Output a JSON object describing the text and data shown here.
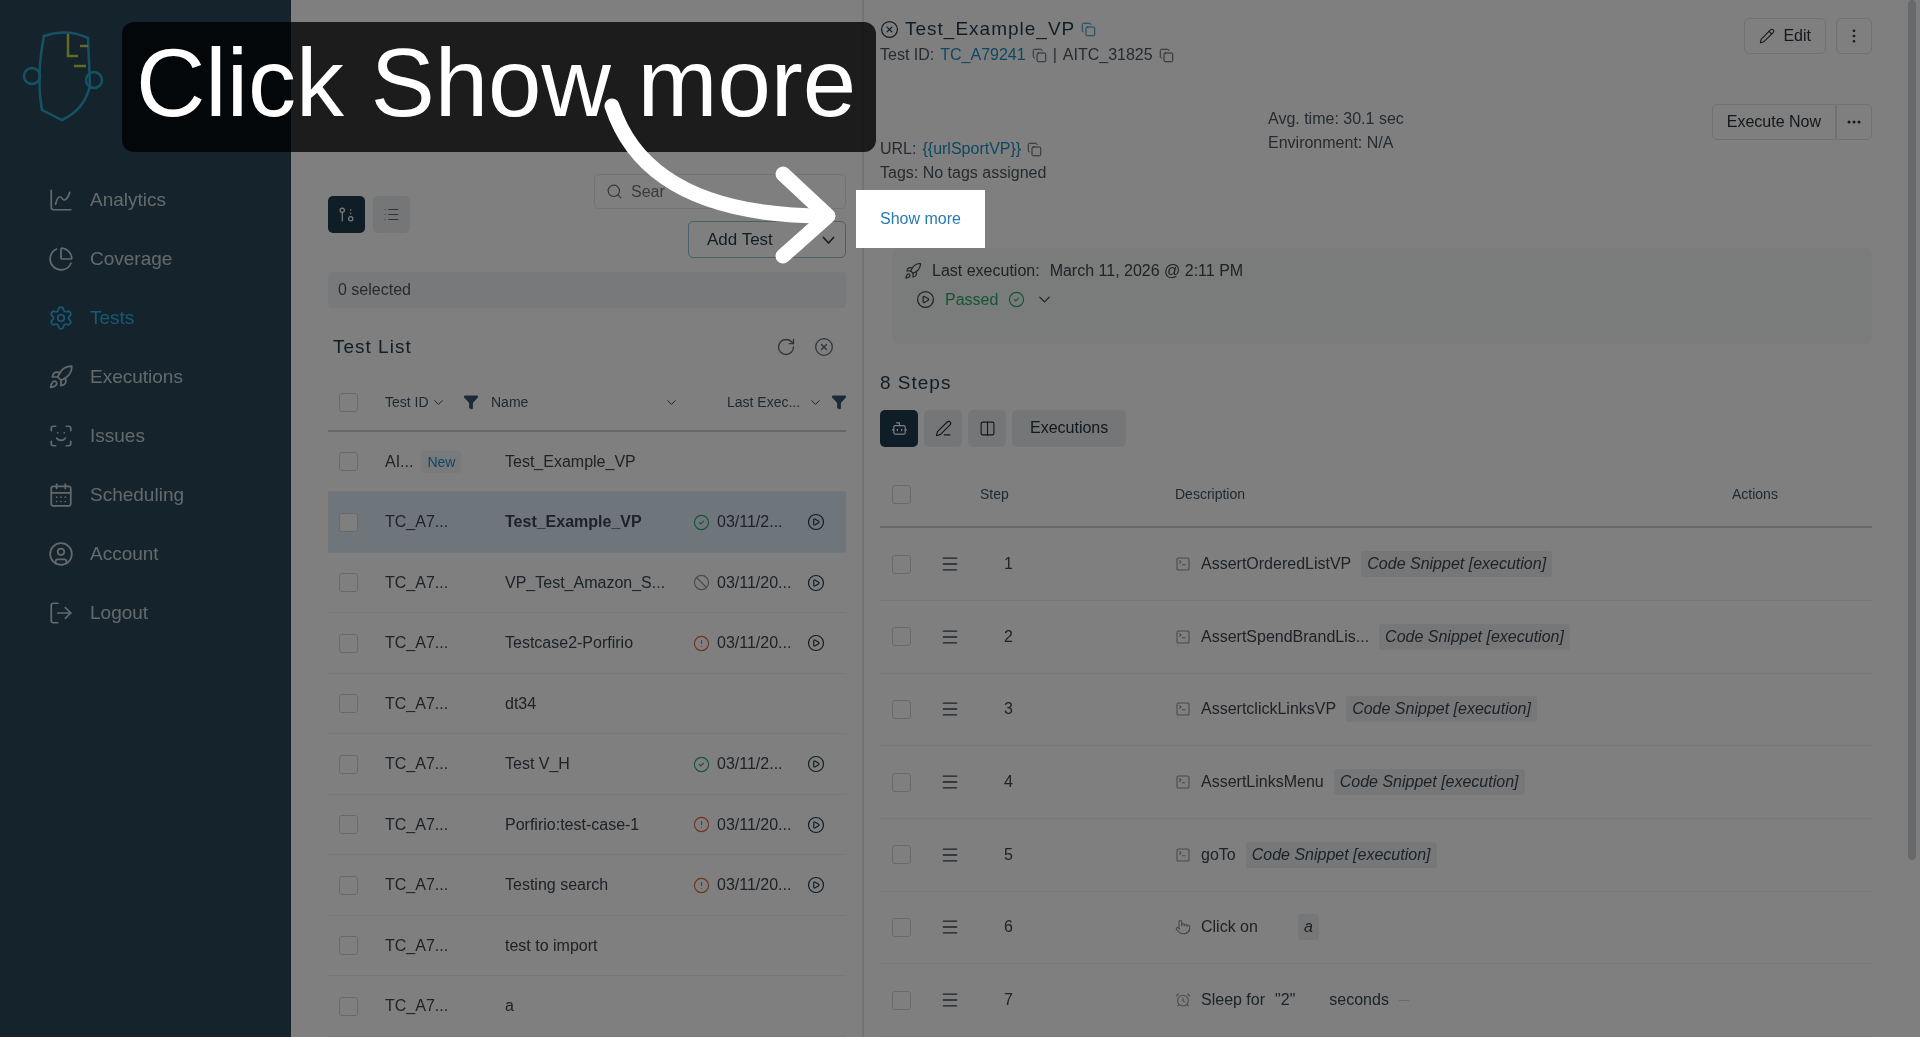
{
  "overlay": {
    "caption": "Click Show more"
  },
  "sidebar": {
    "items": [
      {
        "label": "Analytics",
        "selected": false
      },
      {
        "label": "Coverage",
        "selected": false
      },
      {
        "label": "Tests",
        "selected": true
      },
      {
        "label": "Executions",
        "selected": false
      },
      {
        "label": "Issues",
        "selected": false
      },
      {
        "label": "Scheduling",
        "selected": false
      },
      {
        "label": "Account",
        "selected": false
      },
      {
        "label": "Logout",
        "selected": false
      }
    ]
  },
  "test_list": {
    "view_toggle": [
      {
        "selected": true
      },
      {
        "selected": false
      }
    ],
    "search": {
      "placeholder": "Sear"
    },
    "add_button": "Add Test",
    "selection": "0 selected",
    "title": "Test List",
    "all_checked": false,
    "columns": [
      "Test ID",
      "Name",
      "Last Exec..."
    ],
    "rows": [
      {
        "id": "AI...",
        "badge": "New",
        "name": "Test_Example_VP",
        "checked": false,
        "selected": false
      },
      {
        "id": "TC_A7...",
        "name": "Test_Example_VP",
        "kind": "passed",
        "date": "03/11/2...",
        "checked": false,
        "selected": true
      },
      {
        "id": "TC_A7...",
        "name": "VP_Test_Amazon_S...",
        "kind": "skipped",
        "date": "03/11/20...",
        "checked": false,
        "selected": false
      },
      {
        "id": "TC_A7...",
        "name": "Testcase2-Porfirio",
        "kind": "failed",
        "date": "03/11/20...",
        "checked": false,
        "selected": false
      },
      {
        "id": "TC_A7...",
        "name": "dt34",
        "checked": false,
        "selected": false
      },
      {
        "id": "TC_A7...",
        "name": "Test V_H",
        "kind": "passed",
        "date": "03/11/2...",
        "checked": false,
        "selected": false
      },
      {
        "id": "TC_A7...",
        "name": "Porfirio:test-case-1",
        "kind": "failed",
        "date": "03/11/20...",
        "checked": false,
        "selected": false
      },
      {
        "id": "TC_A7...",
        "name": "Testing search",
        "kind": "failed",
        "date": "03/11/20...",
        "checked": false,
        "selected": false
      },
      {
        "id": "TC_A7...",
        "name": "test to import",
        "checked": false,
        "selected": false
      },
      {
        "id": "TC_A7...",
        "name": "a",
        "checked": false,
        "selected": false
      }
    ]
  },
  "detail": {
    "title": "Test_Example_VP",
    "test_id_label": "Test ID:",
    "test_id": "TC_A79241",
    "separator": "|",
    "alt_id": "AITC_31825",
    "edit_button": "Edit",
    "execute_button": "Execute Now",
    "avg_time": "Avg. time: 30.1 sec",
    "environment": "Environment: N/A",
    "url_label": "URL:",
    "url": "{{urlSportVP}}",
    "tags": "Tags: No tags assigned",
    "show_more": "Show more",
    "last_execution": {
      "label": "Last execution:",
      "date": "March 11, 2026 @ 2:11 PM",
      "status": "Passed"
    },
    "steps_title": "8 Steps",
    "tabs": [
      {
        "kind": "icon",
        "selected": true
      },
      {
        "kind": "icon",
        "selected": false
      },
      {
        "kind": "icon",
        "selected": false
      },
      {
        "kind": "text",
        "label": "Executions",
        "selected": false
      }
    ],
    "columns": [
      "Step",
      "Description",
      "Actions"
    ],
    "all_checked": false,
    "steps": [
      {
        "number": "1",
        "kind": "snippet",
        "name": "AssertOrderedListVP",
        "tag": "Code Snippet [execution]",
        "checked": false
      },
      {
        "number": "2",
        "kind": "snippet",
        "name": "AssertSpendBrandLis...",
        "tag": "Code Snippet [execution]",
        "checked": false
      },
      {
        "number": "3",
        "kind": "snippet",
        "name": "AssertclickLinksVP",
        "tag": "Code Snippet [execution]",
        "checked": false
      },
      {
        "number": "4",
        "kind": "snippet",
        "name": "AssertLinksMenu",
        "tag": "Code Snippet [execution]",
        "checked": false
      },
      {
        "number": "5",
        "kind": "snippet",
        "name": "goTo",
        "tag": "Code Snippet [execution]",
        "checked": false
      },
      {
        "number": "6",
        "kind": "click",
        "name": "Click on",
        "tag": "a",
        "checked": false
      },
      {
        "number": "7",
        "kind": "sleep",
        "name": "Sleep for",
        "value": "\"2\"",
        "unit": "seconds",
        "checked": false
      }
    ]
  }
}
